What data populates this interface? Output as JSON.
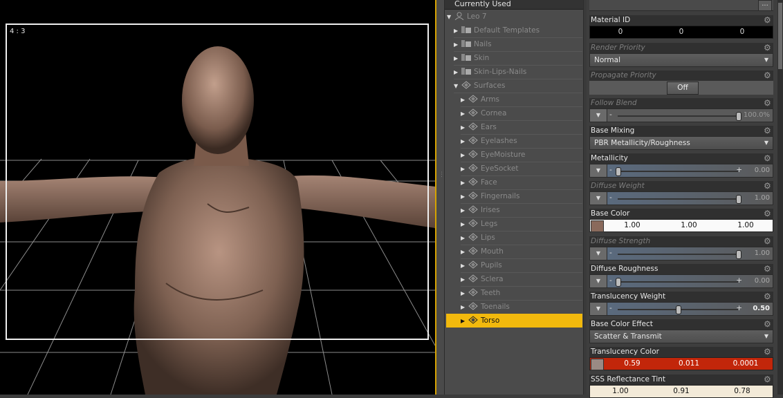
{
  "viewport": {
    "aspect_label": "4 : 3"
  },
  "tree": {
    "header": "Currently Used",
    "figure": "Leo 7",
    "groups": [
      "Default Templates",
      "Nails",
      "Skin",
      "Skin-Lips-Nails",
      "Surfaces"
    ],
    "surfaces": [
      "Arms",
      "Cornea",
      "Ears",
      "Eyelashes",
      "EyeMoisture",
      "EyeSocket",
      "Face",
      "Fingernails",
      "Irises",
      "Legs",
      "Lips",
      "Mouth",
      "Pupils",
      "Sclera",
      "Teeth",
      "Toenails"
    ],
    "selected": "Torso"
  },
  "props": {
    "more_button": "...",
    "material_id": {
      "label": "Material ID",
      "values": [
        "0",
        "0",
        "0"
      ]
    },
    "render_priority": {
      "label": "Render Priority",
      "value": "Normal"
    },
    "propagate_priority": {
      "label": "Propagate Priority",
      "value": "Off"
    },
    "follow_blend": {
      "label": "Follow Blend",
      "value": "100.0%",
      "level": 1.0
    },
    "base_mixing": {
      "label": "Base Mixing",
      "value": "PBR Metallicity/Roughness"
    },
    "metallicity": {
      "label": "Metallicity",
      "value": "0.00",
      "level": 0.0
    },
    "diffuse_weight": {
      "label": "Diffuse Weight",
      "value": "1.00",
      "level": 1.0
    },
    "base_color": {
      "label": "Base Color",
      "values": [
        "1.00",
        "1.00",
        "1.00"
      ]
    },
    "diffuse_strength": {
      "label": "Diffuse Strength",
      "value": "1.00",
      "level": 1.0
    },
    "diffuse_roughness": {
      "label": "Diffuse Roughness",
      "value": "0.00",
      "level": 0.0
    },
    "translucency_weight": {
      "label": "Translucency Weight",
      "value": "0.50",
      "level": 0.5
    },
    "base_color_effect": {
      "label": "Base Color Effect",
      "value": "Scatter & Transmit"
    },
    "translucency_color": {
      "label": "Translucency Color",
      "values": [
        "0.59",
        "0.011",
        "0.0001"
      ]
    },
    "sss_reflectance_tint": {
      "label": "SSS Reflectance Tint",
      "values": [
        "1.00",
        "0.91",
        "0.78"
      ]
    }
  },
  "colors": {
    "selection": "#f2b90d",
    "viewport_border": "#d6a300",
    "translucency_red": "#c2260a"
  }
}
